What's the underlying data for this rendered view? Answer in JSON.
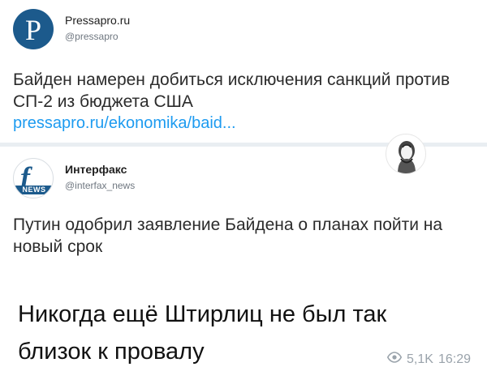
{
  "tweet1": {
    "avatar_letter": "P",
    "author": "Pressapro.ru",
    "handle": "@pressapro",
    "text": "Байден намерен добиться исключения санкций против СП-2 из бюджета США",
    "link": "pressapro.ru/ekonomika/baid..."
  },
  "tweet2": {
    "avatar_letter": "f",
    "avatar_badge": "NEWS",
    "author": "Интерфакс",
    "handle": "@interfax_news",
    "text": "Путин одобрил заявление Байдена о планах пойти на новый срок"
  },
  "caption": {
    "line1": "Никогда ещё Штирлиц не был так",
    "line2": "близок к провалу"
  },
  "meta": {
    "views": "5,1K",
    "time": "16:29"
  },
  "icons": {
    "views": "eye-icon",
    "portrait": "portrait-icon"
  },
  "colors": {
    "link": "#1d9bf0",
    "separator": "#e9eef2",
    "meta": "#9aa3ab"
  }
}
